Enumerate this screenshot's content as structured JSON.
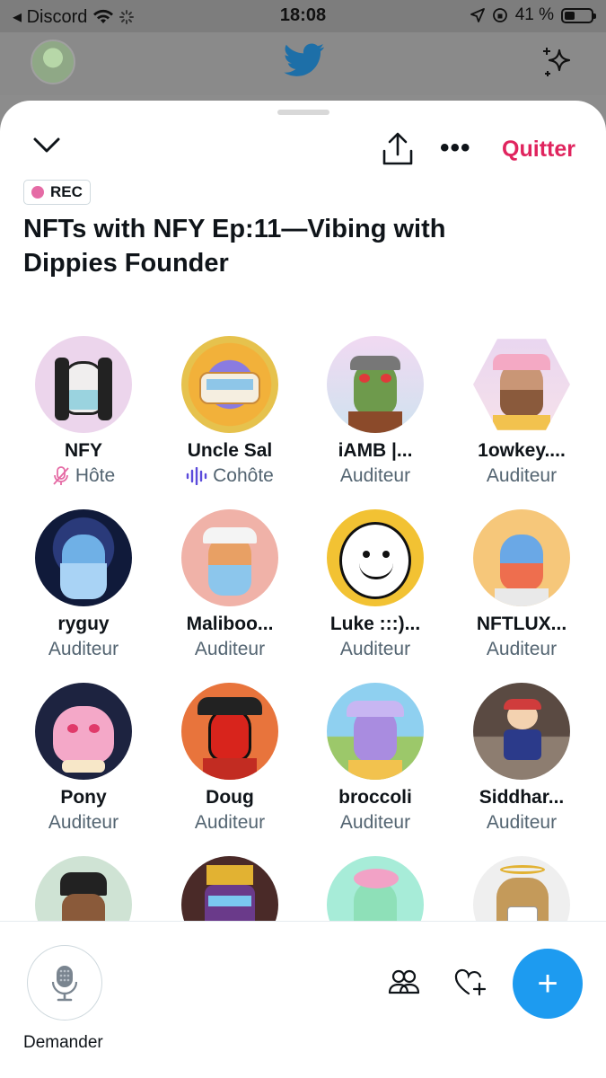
{
  "status_bar": {
    "carrier": "◂ Discord",
    "time": "18:08",
    "battery": "41 %",
    "battery_level": 0.41
  },
  "space": {
    "rec_label": "REC",
    "title": "NFTs with NFY Ep:11—Vibing with Dippies Founder",
    "quit_label": "Quitter"
  },
  "participants": [
    {
      "name": "NFY",
      "role": "Hôte",
      "role_icon": "mic-off-icon"
    },
    {
      "name": "Uncle Sal",
      "role": "Cohôte",
      "role_icon": "speaking-icon"
    },
    {
      "name": "iAMB |...",
      "role": "Auditeur"
    },
    {
      "name": "1owkey....",
      "role": "Auditeur"
    },
    {
      "name": "ryguy",
      "role": "Auditeur"
    },
    {
      "name": "Maliboo...",
      "role": "Auditeur"
    },
    {
      "name": "Luke :::)...",
      "role": "Auditeur"
    },
    {
      "name": "NFTLUX...",
      "role": "Auditeur"
    },
    {
      "name": "Pony",
      "role": "Auditeur"
    },
    {
      "name": "Doug",
      "role": "Auditeur"
    },
    {
      "name": "broccoli",
      "role": "Auditeur"
    },
    {
      "name": "Siddhar...",
      "role": "Auditeur"
    },
    {
      "name": "",
      "role": ""
    },
    {
      "name": "",
      "role": ""
    },
    {
      "name": "",
      "role": ""
    },
    {
      "name": "",
      "role": ""
    }
  ],
  "bottom": {
    "request_label": "Demander",
    "fab_label": "+"
  },
  "colors": {
    "accent": "#1d9bf0",
    "quit": "#e0245e",
    "rec_dot": "#e56ba5",
    "host_mic": "#e56ba5",
    "cohost_wave": "#5b4bdb"
  }
}
